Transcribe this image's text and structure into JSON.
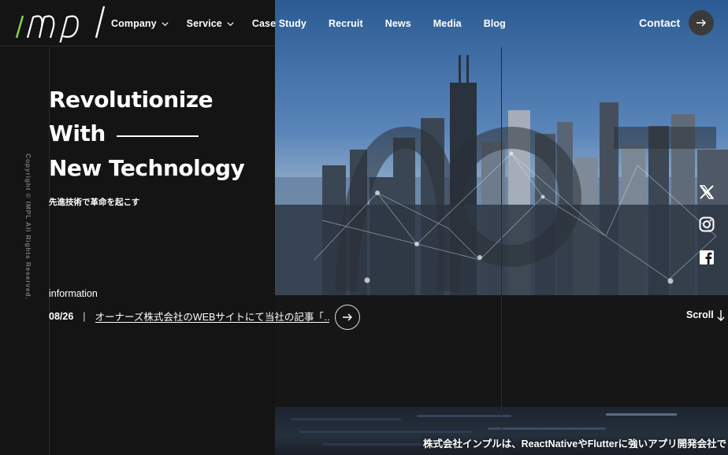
{
  "header": {
    "logo_text": "impl",
    "nav": [
      {
        "label": "Company",
        "has_dropdown": true
      },
      {
        "label": "Service",
        "has_dropdown": true
      },
      {
        "label": "Case Study",
        "has_dropdown": false
      },
      {
        "label": "Recruit",
        "has_dropdown": false
      },
      {
        "label": "News",
        "has_dropdown": false
      },
      {
        "label": "Media",
        "has_dropdown": false
      },
      {
        "label": "Blog",
        "has_dropdown": false
      }
    ],
    "contact_label": "Contact"
  },
  "hero": {
    "headline_line1": "Revolutionize",
    "headline_line2": "With",
    "headline_line3": "New Technology",
    "subcopy": "先進技術で革命を起こす"
  },
  "sidebar": {
    "copyright": "Copyright © IMPL All Rights Reserved."
  },
  "information": {
    "label": "information",
    "date": "08/26",
    "separator": "|",
    "link_text": "オーナーズ株式会社のWEBサイトにて当社の記事「…"
  },
  "social": [
    "x-icon",
    "instagram-icon",
    "facebook-icon"
  ],
  "scroll_label": "Scroll",
  "bottom_copy": "株式会社インプルは、ReactNativeやFlutterに強いアプリ開発会社で",
  "colors": {
    "background": "#161616",
    "accent_logo": "#8fd14f",
    "text": "#ffffff"
  }
}
